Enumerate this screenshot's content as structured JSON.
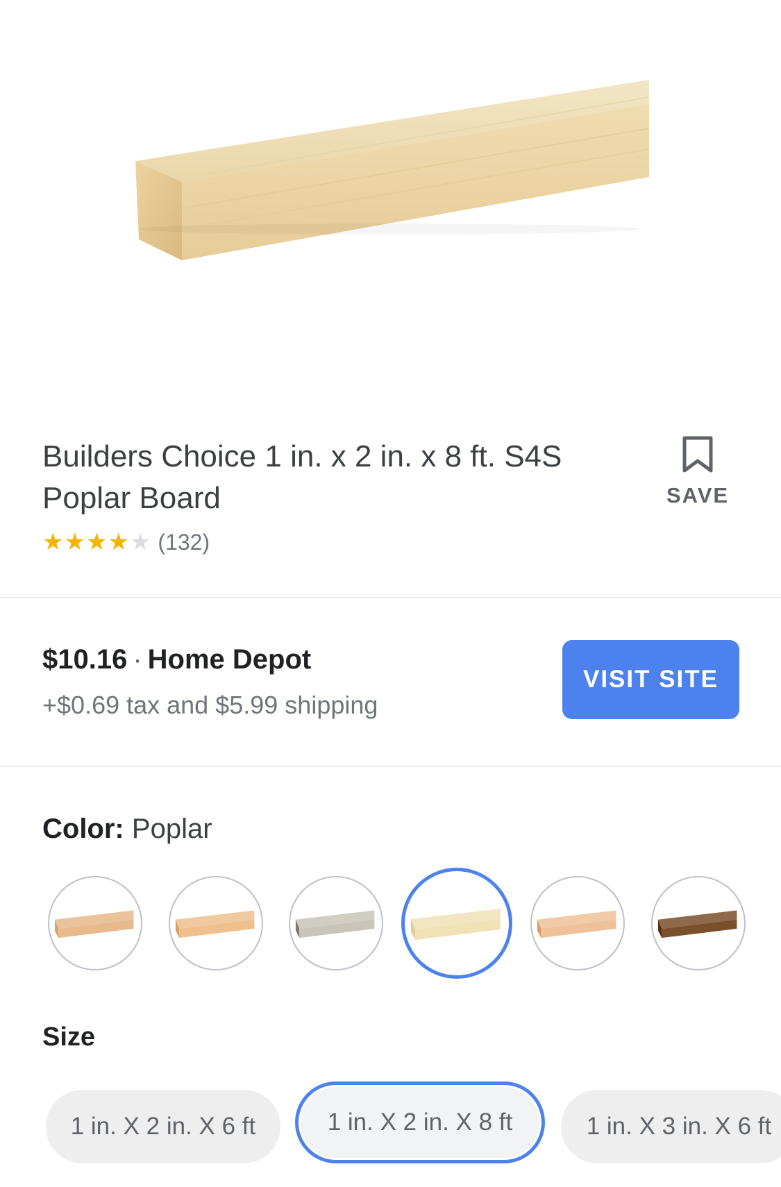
{
  "product": {
    "title": "Builders Choice 1 in. x 2 in. x 8 ft. S4S Poplar Board",
    "rating": 4,
    "rating_max": 5,
    "review_count": "(132)",
    "image_icon": "poplar-board-image"
  },
  "save": {
    "label": "SAVE",
    "icon": "bookmark-icon"
  },
  "offer": {
    "price": "$10.16",
    "separator": "·",
    "store": "Home Depot",
    "extra": "+$0.69 tax and $5.99 shipping",
    "visit_label": "VISIT SITE",
    "visit_color": "#4d82ee"
  },
  "color": {
    "label": "Color:",
    "value": "Poplar",
    "swatches": [
      {
        "name": "swatch-1",
        "selected": false,
        "wood": "#e8b98a",
        "edge": "#d9a06b"
      },
      {
        "name": "swatch-2",
        "selected": false,
        "wood": "#efc08e",
        "edge": "#dca06a"
      },
      {
        "name": "swatch-3",
        "selected": false,
        "wood": "#c8c5b8",
        "edge": "#7e7b70"
      },
      {
        "name": "swatch-poplar",
        "selected": true,
        "wood": "#f1e1b6",
        "edge": "#e2cc98"
      },
      {
        "name": "swatch-5",
        "selected": false,
        "wood": "#efc198",
        "edge": "#d9996a"
      },
      {
        "name": "swatch-6",
        "selected": false,
        "wood": "#7a4f2c",
        "edge": "#4f3018"
      }
    ]
  },
  "size": {
    "label": "Size",
    "options": [
      {
        "label": "1 in. X 2 in. X 6 ft",
        "selected": false
      },
      {
        "label": "1 in. X 2 in. X 8 ft",
        "selected": true
      },
      {
        "label": "1 in. X 3 in. X 6 ft",
        "selected": false
      }
    ]
  }
}
